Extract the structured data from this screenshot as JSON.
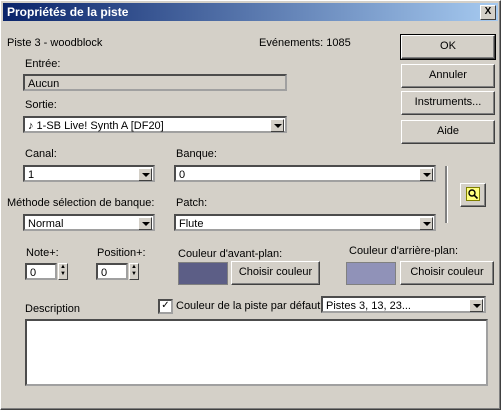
{
  "window": {
    "title": "Propriétés de la piste",
    "close": "X"
  },
  "track": {
    "name": "Piste 3 - woodblock",
    "events": "Evénements: 1085"
  },
  "input": {
    "label": "Entrée:",
    "value": "Aucun"
  },
  "output": {
    "label": "Sortie:",
    "value": "♪ 1-SB Live! Synth A [DF20]"
  },
  "channel": {
    "label": "Canal:",
    "value": "1"
  },
  "bank": {
    "label": "Banque:",
    "value": "0"
  },
  "bank_method": {
    "label": "Méthode sélection de banque:",
    "value": "Normal"
  },
  "patch": {
    "label": "Patch:",
    "value": "Flute"
  },
  "note": {
    "label": "Note+:",
    "value": "0"
  },
  "position": {
    "label": "Position+:",
    "value": "0"
  },
  "foreground": {
    "label": "Couleur d'avant-plan:",
    "color": "#5c5e86",
    "button": "Choisir couleur"
  },
  "background": {
    "label": "Couleur d'arrière-plan:",
    "color": "#9092b8",
    "button": "Choisir couleur"
  },
  "description": {
    "label": "Description",
    "value": ""
  },
  "default_color": {
    "label": "Couleur de la piste par défaut:",
    "checked": true,
    "check": "✓"
  },
  "tracks_select": {
    "value": "Pistes 3, 13, 23..."
  },
  "buttons": {
    "ok": "OK",
    "cancel": "Annuler",
    "instruments": "Instruments...",
    "help": "Aide"
  },
  "spin": {
    "up": "▲",
    "down": "▼"
  }
}
